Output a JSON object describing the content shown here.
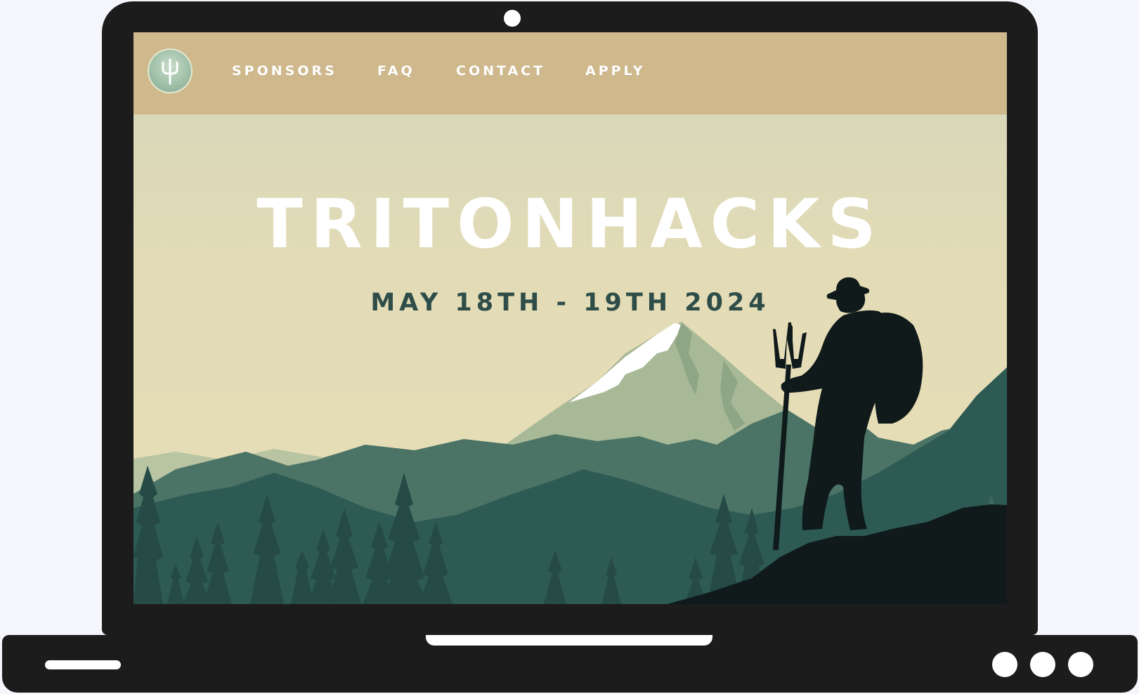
{
  "site": {
    "logo_icon": "trident-icon",
    "nav": [
      {
        "label": "SPONSORS"
      },
      {
        "label": "FAQ"
      },
      {
        "label": "CONTACT"
      },
      {
        "label": "APPLY"
      }
    ],
    "hero": {
      "title": "TRITONHACKS",
      "dates": "MAY 18TH - 19TH 2024"
    }
  },
  "colors": {
    "nav_bg": "#cfb98c",
    "sky": "#e6ddb5",
    "title": "#ffffff",
    "dates": "#2e4d48",
    "mountain_far": "#a8b997",
    "mountain_mid": "#4b7466",
    "mountain_near": "#2e5a54",
    "silhouette": "#101a1b",
    "laptop": "#1c1c1c"
  }
}
